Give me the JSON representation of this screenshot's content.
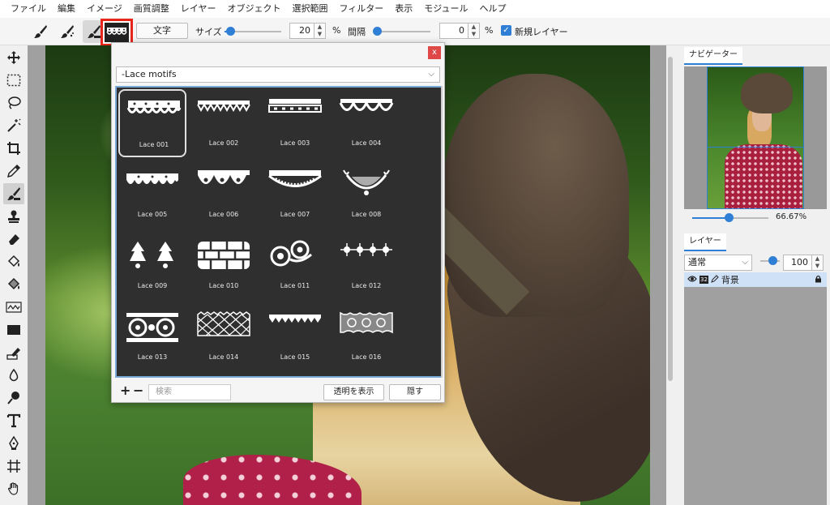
{
  "menu": [
    "ファイル",
    "編集",
    "イメージ",
    "画質調整",
    "レイヤー",
    "オブジェクト",
    "選択範囲",
    "フィルター",
    "表示",
    "モジュール",
    "ヘルプ"
  ],
  "options": {
    "text_button": "文字",
    "size_label": "サイズ",
    "size_value": "20",
    "size_unit": "%",
    "spacing_label": "間隔",
    "spacing_value": "0",
    "spacing_unit": "%",
    "new_layer_label": "新規レイヤー",
    "new_layer_checked": true,
    "size_slider_fraction": 0.1,
    "spacing_slider_fraction": 0.05
  },
  "tools": [
    "move-tool",
    "rect-select-tool",
    "lasso-tool",
    "magic-wand-tool",
    "crop-tool",
    "eyedropper-tool",
    "brush-tool",
    "stamp-tool",
    "eraser-tool",
    "fill-tool",
    "fill-pattern-tool",
    "wave-tool",
    "rect-shape-tool",
    "pen-edit-tool",
    "drop-tool",
    "dodge-tool",
    "text-tool",
    "pen-tool",
    "transform-tool",
    "hand-tool"
  ],
  "brush_dialog": {
    "category": "-Lace motifs",
    "brushes": [
      "Lace 001",
      "Lace 002",
      "Lace 003",
      "Lace 004",
      "Lace 005",
      "Lace 006",
      "Lace 007",
      "Lace 008",
      "Lace 009",
      "Lace 010",
      "Lace 011",
      "Lace 012",
      "Lace 013",
      "Lace 014",
      "Lace 015",
      "Lace 016"
    ],
    "selected_index": 0,
    "add_symbol": "+",
    "remove_symbol": "−",
    "search_placeholder": "検索",
    "show_transparent_button": "透明を表示",
    "hide_button": "隠す",
    "close_symbol": "x"
  },
  "navigator": {
    "tab": "ナビゲーター",
    "zoom": "66.67%"
  },
  "layers": {
    "tab": "レイヤー",
    "blend_mode": "通常",
    "opacity": "100",
    "rows": [
      {
        "badge": "32",
        "name": "背景",
        "locked": true
      }
    ]
  },
  "colors": {
    "accent": "#2f7fd6",
    "highlight": "#e8251b",
    "dialog_grid": "#2f2f2f"
  }
}
